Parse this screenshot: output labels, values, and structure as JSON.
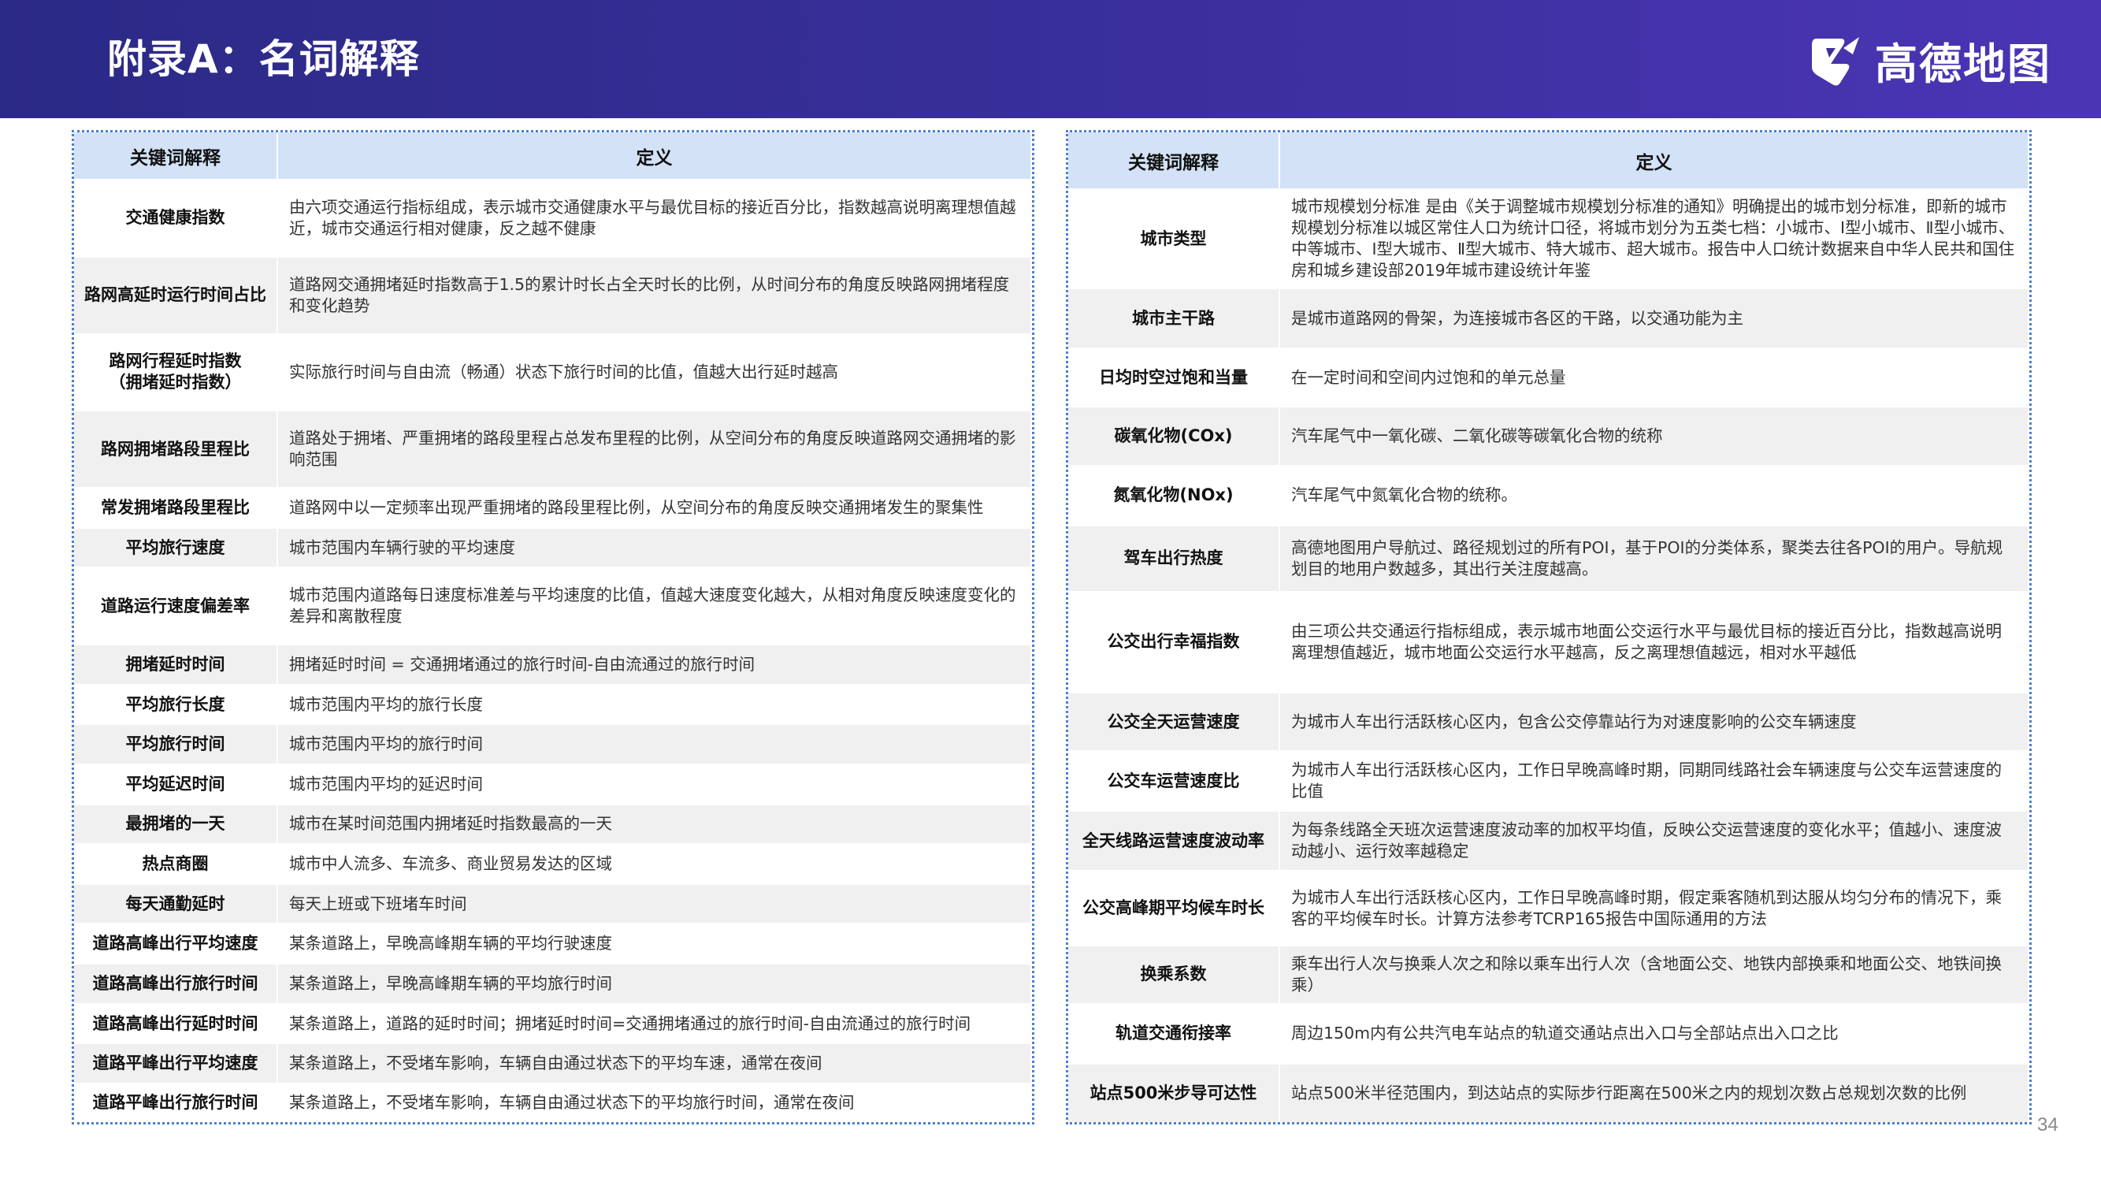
{
  "header": {
    "title": "附录A：名词解释"
  },
  "logo": {
    "text": "高德地图",
    "icon": "amap-logo-icon"
  },
  "left_table": {
    "headers": [
      "关键词解释",
      "定义"
    ],
    "rows": [
      [
        "交通健康指数",
        "由六项交通运行指标组成，表示城市交通健康水平与最优目标的接近百分比，指数越高说明离理想值越近，城市交通运行相对健康，反之越不健康"
      ],
      [
        "路网高延时运行时间占比",
        "道路网交通拥堵延时指数高于1.5的累计时长占全天时长的比例，从时间分布的角度反映路网拥堵程度和变化趋势"
      ],
      [
        "路网行程延时指数\n（拥堵延时指数）",
        "实际旅行时间与自由流（畅通）状态下旅行时间的比值，值越大出行延时越高"
      ],
      [
        "路网拥堵路段里程比",
        "道路处于拥堵、严重拥堵的路段里程占总发布里程的比例，从空间分布的角度反映道路网交通拥堵的影响范围"
      ],
      [
        "常发拥堵路段里程比",
        "道路网中以一定频率出现严重拥堵的路段里程比例，从空间分布的角度反映交通拥堵发生的聚集性"
      ],
      [
        "平均旅行速度",
        "城市范围内车辆行驶的平均速度"
      ],
      [
        "道路运行速度偏差率",
        "城市范围内道路每日速度标准差与平均速度的比值，值越大速度变化越大，从相对角度反映速度变化的差异和离散程度"
      ],
      [
        "拥堵延时时间",
        "拥堵延时时间 = 交通拥堵通过的旅行时间-自由流通过的旅行时间"
      ],
      [
        "平均旅行长度",
        "城市范围内平均的旅行长度"
      ],
      [
        "平均旅行时间",
        "城市范围内平均的旅行时间"
      ],
      [
        "平均延迟时间",
        "城市范围内平均的延迟时间"
      ],
      [
        "最拥堵的一天",
        "城市在某时间范围内拥堵延时指数最高的一天"
      ],
      [
        "热点商圈",
        "城市中人流多、车流多、商业贸易发达的区域"
      ],
      [
        "每天通勤延时",
        "每天上班或下班堵车时间"
      ],
      [
        "道路高峰出行平均速度",
        "某条道路上，早晚高峰期车辆的平均行驶速度"
      ],
      [
        "道路高峰出行旅行时间",
        "某条道路上，早晚高峰期车辆的平均旅行时间"
      ],
      [
        "道路高峰出行延时时间",
        "某条道路上，道路的延时时间；拥堵延时时间=交通拥堵通过的旅行时间-自由流通过的旅行时间"
      ],
      [
        "道路平峰出行平均速度",
        "某条道路上，不受堵车影响，车辆自由通过状态下的平均车速，通常在夜间"
      ],
      [
        "道路平峰出行旅行时间",
        "某条道路上，不受堵车影响，车辆自由通过状态下的平均旅行时间，通常在夜间"
      ]
    ]
  },
  "right_table": {
    "headers": [
      "关键词解释",
      "定义"
    ],
    "rows": [
      [
        "城市类型",
        "城市规模划分标准 是由《关于调整城市规模划分标准的通知》明确提出的城市划分标准，即新的城市规模划分标准以城区常住人口为统计口径，将城市划分为五类七档：小城市、Ⅰ型小城市、Ⅱ型小城市、中等城市、Ⅰ型大城市、Ⅱ型大城市、特大城市、超大城市。报告中人口统计数据来自中华人民共和国住房和城乡建设部2019年城市建设统计年鉴"
      ],
      [
        "城市主干路",
        "是城市道路网的骨架，为连接城市各区的干路，以交通功能为主"
      ],
      [
        "日均时空过饱和当量",
        "在一定时间和空间内过饱和的单元总量"
      ],
      [
        "碳氧化物(COx)",
        "汽车尾气中一氧化碳、二氧化碳等碳氧化合物的统称"
      ],
      [
        "氮氧化物(NOx)",
        "汽车尾气中氮氧化合物的统称。"
      ],
      [
        "驾车出行热度",
        "高德地图用户导航过、路径规划过的所有POI，基于POI的分类体系，聚类去往各POI的用户。导航规划目的地用户数越多，其出行关注度越高。"
      ],
      [
        "公交出行幸福指数",
        "由三项公共交通运行指标组成，表示城市地面公交运行水平与最优目标的接近百分比，指数越高说明离理想值越近，城市地面公交运行水平越高，反之离理想值越远，相对水平越低"
      ],
      [
        "公交全天运营速度",
        "为城市人车出行活跃核心区内，包含公交停靠站行为对速度影响的公交车辆速度"
      ],
      [
        "公交车运营速度比",
        "为城市人车出行活跃核心区内，工作日早晚高峰时期，同期同线路社会车辆速度与公交车运营速度的比值"
      ],
      [
        "全天线路运营速度波动率",
        "为每条线路全天班次运营速度波动率的加权平均值，反映公交运营速度的变化水平；值越小、速度波动越小、运行效率越稳定"
      ],
      [
        "公交高峰期平均候车时长",
        "为城市人车出行活跃核心区内，工作日早晚高峰时期，假定乘客随机到达服从均匀分布的情况下，乘客的平均候车时长。计算方法参考TCRP165报告中国际通用的方法"
      ],
      [
        "换乘系数",
        "乘车出行人次与换乘人次之和除以乘车出行人次（含地面公交、地铁内部换乘和地面公交、地铁间换乘）"
      ],
      [
        "轨道交通衔接率",
        "周边150m内有公共汽电车站点的轨道交通站点出入口与全部站点出入口之比"
      ],
      [
        "站点500米步导可达性",
        "站点500米半径范围内，到达站点的实际步行距离在500米之内的规划次数占总规划次数的比例"
      ]
    ]
  },
  "page_number": "34"
}
